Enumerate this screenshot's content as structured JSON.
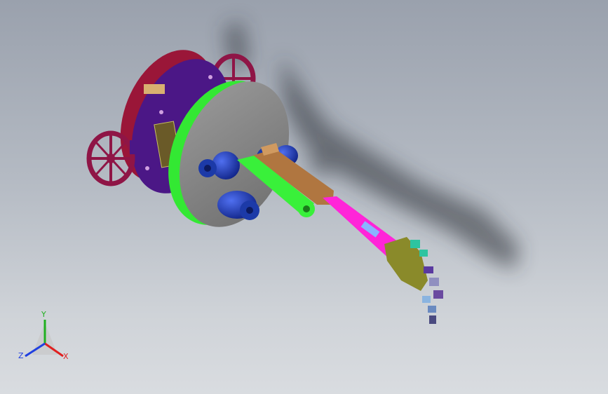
{
  "viewport": {
    "background_top": "#9aa1ad",
    "background_bottom": "#d9dce0"
  },
  "triad": {
    "x_label": "X",
    "y_label": "Y",
    "z_label": "Z",
    "x_color": "#e02020",
    "y_color": "#20b020",
    "z_color": "#2040e0"
  },
  "model": {
    "part_colors": {
      "rear_plate": "#9a1638",
      "mid_plate": "#4b1786",
      "front_disc": "#8d8d8d",
      "disc_rim": "#33e833",
      "wheels": "#8f1546",
      "motors": "#1c3aa8",
      "upper_arm": "#39f03a",
      "bracket": "#b07640",
      "forearm": "#ff25d8",
      "hand": "#8a8a2a"
    }
  }
}
